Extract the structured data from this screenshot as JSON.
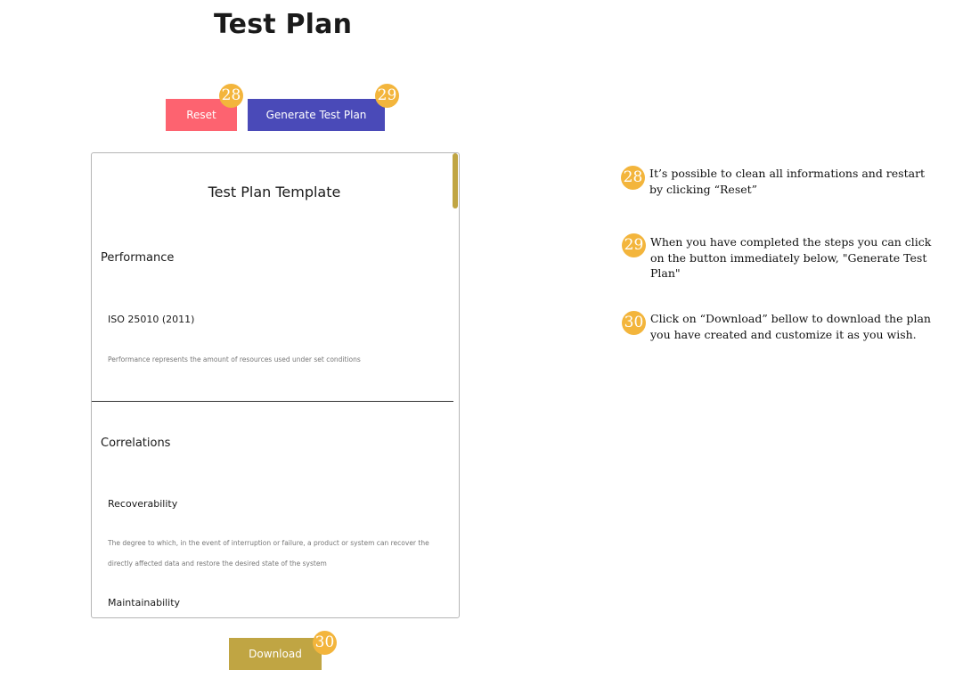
{
  "page": {
    "title": "Test Plan"
  },
  "buttons": {
    "reset": "Reset",
    "generate": "Generate Test Plan",
    "download": "Download"
  },
  "badges": {
    "reset": "28",
    "generate": "29",
    "download": "30"
  },
  "template": {
    "title": "Test Plan Template",
    "sections": [
      {
        "heading": "Performance",
        "items": [
          {
            "title": "ISO 25010 (2011)",
            "description": "Performance represents the amount of resources used under set conditions"
          }
        ]
      },
      {
        "heading": "Correlations",
        "items": [
          {
            "title": "Recoverability",
            "description": "The degree to which, in the event of interruption or failure, a product or system can recover the directly affected data and restore the desired state of the system"
          },
          {
            "title": "Maintainability",
            "description": ""
          }
        ]
      }
    ]
  },
  "notes": [
    {
      "number": "28",
      "text": "It’s possible to clean all informations and restart by clicking “Reset”"
    },
    {
      "number": "29",
      "text": "When you have completed the steps you can click on the button immediately below, \"Generate Test Plan\""
    },
    {
      "number": "30",
      "text": "Click on “Download” bellow to download the plan you have created and customize it as you wish."
    }
  ],
  "colors": {
    "reset": "#fd6370",
    "generate": "#4a4ab8",
    "download": "#c0a543",
    "badge": "#f3b53c"
  }
}
